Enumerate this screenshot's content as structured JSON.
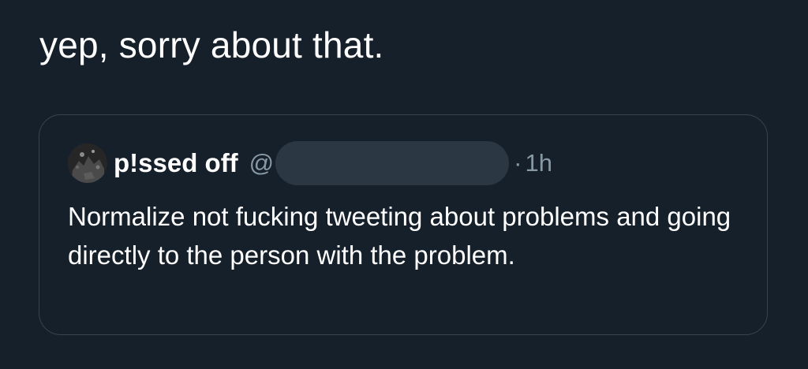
{
  "tweet": {
    "text": "yep, sorry about that."
  },
  "quoted_tweet": {
    "author": {
      "display_name": "p!ssed off",
      "handle_prefix": "@",
      "avatar_icon": "avatar-icon"
    },
    "separator": "·",
    "timestamp": "1h",
    "text": "Normalize not fucking tweeting about problems and going directly to the person with the problem."
  },
  "colors": {
    "background": "#15202b",
    "text_primary": "#ffffff",
    "text_secondary": "#8899a6",
    "border": "#38444d",
    "redaction": "#2b3742"
  }
}
